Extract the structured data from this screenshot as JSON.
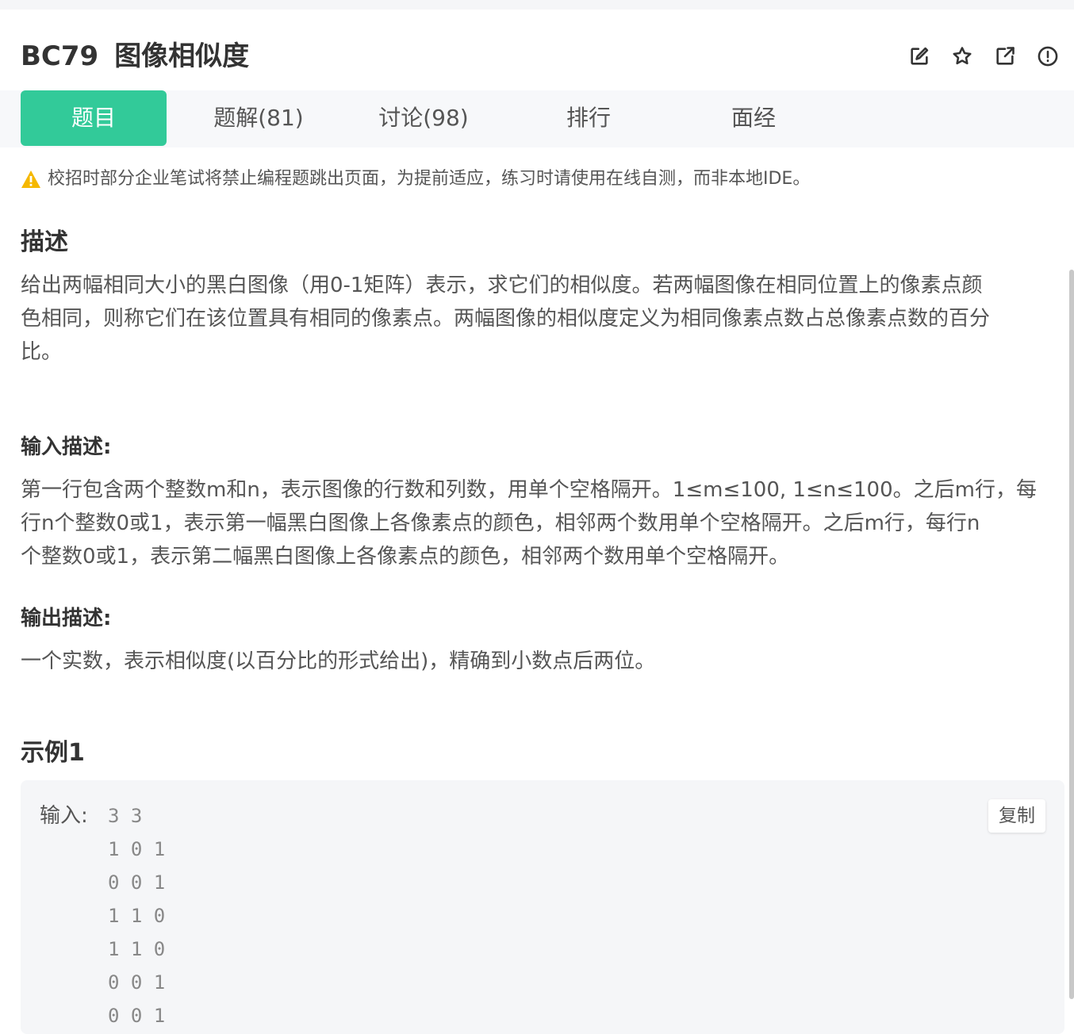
{
  "problem": {
    "code": "BC79",
    "title": "图像相似度"
  },
  "tabs": [
    {
      "label": "题目"
    },
    {
      "label": "题解(81)"
    },
    {
      "label": "讨论(98)"
    },
    {
      "label": "排行"
    },
    {
      "label": "面经"
    }
  ],
  "icons": {
    "edit": "edit-icon",
    "star": "star-icon",
    "share": "share-icon",
    "report": "report-icon",
    "warning": "warning-icon"
  },
  "colors": {
    "accent": "#32ca99",
    "warning": "#f5b800"
  },
  "notice": {
    "text": "校招时部分企业笔试将禁止编程题跳出页面，为提前适应，练习时请使用在线自测，而非本地IDE。"
  },
  "description": {
    "heading": "描述",
    "lines": [
      "给出两幅相同大小的黑白图像（用0-1矩阵）表示，求它们的相似度。若两幅图像在相同位置上的像素点颜",
      "色相同，则称它们在该位置具有相同的像素点。两幅图像的相似度定义为相同像素点数占总像素点数的百分",
      "比。"
    ]
  },
  "input_desc": {
    "heading": "输入描述:",
    "lines": [
      "第一行包含两个整数m和n，表示图像的行数和列数，用单个空格隔开。1≤m≤100, 1≤n≤100。之后m行，每",
      "行n个整数0或1，表示第一幅黑白图像上各像素点的颜色，相邻两个数用单个空格隔开。之后m行，每行n",
      "个整数0或1，表示第二幅黑白图像上各像素点的颜色，相邻两个数用单个空格隔开。"
    ]
  },
  "output_desc": {
    "heading": "输出描述:",
    "lines": [
      "一个实数，表示相似度(以百分比的形式给出)，精确到小数点后两位。"
    ]
  },
  "example": {
    "heading": "示例1",
    "input_label": "输入:",
    "input_lines": [
      "3 3",
      "1 0 1",
      "0 0 1",
      "1 1 0",
      "1 1 0",
      "0 0 1",
      "0 0 1"
    ],
    "copy_label": "复制"
  }
}
